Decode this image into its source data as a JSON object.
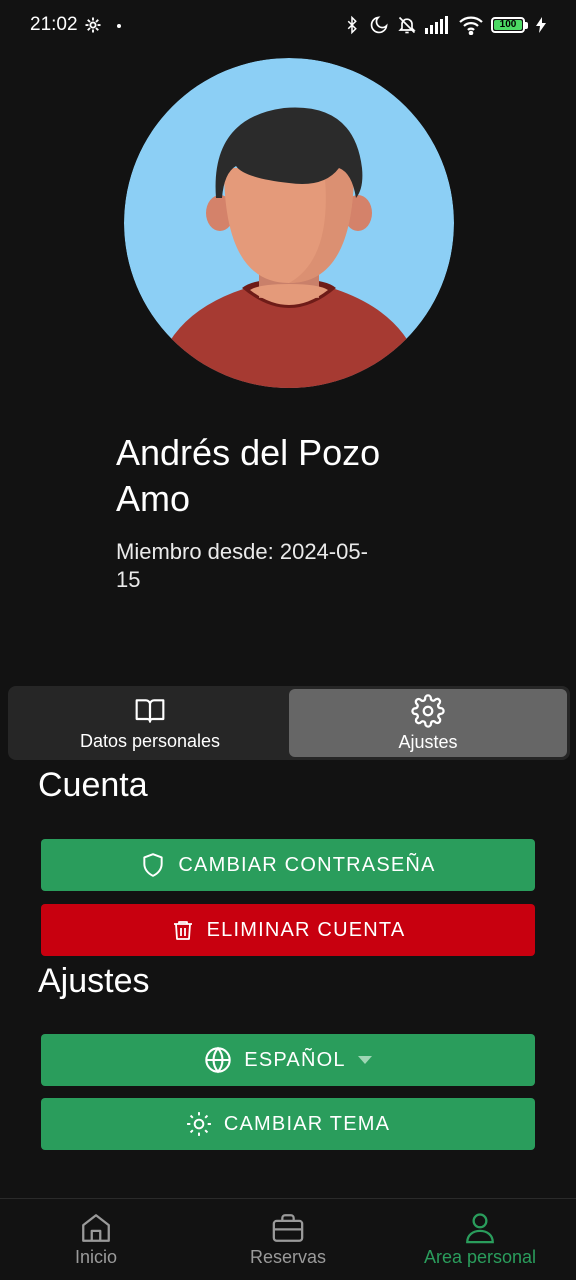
{
  "status_bar": {
    "time": "21:02",
    "battery_level": "100"
  },
  "profile": {
    "name": "Andrés del Pozo Amo",
    "member_since": "Miembro desde: 2024-05-15"
  },
  "tabs": [
    {
      "label": "Datos personales",
      "icon": "book-icon",
      "active": false
    },
    {
      "label": "Ajustes",
      "icon": "gear-icon",
      "active": true
    }
  ],
  "account_section": {
    "title": "Cuenta",
    "change_password_label": "CAMBIAR CONTRASEÑA",
    "delete_account_label": "ELIMINAR CUENTA"
  },
  "settings_section": {
    "title": "Ajustes",
    "language_label": "ESPAÑOL",
    "theme_label": "CAMBIAR TEMA"
  },
  "bottom_nav": [
    {
      "label": "Inicio",
      "icon": "home-icon",
      "active": false
    },
    {
      "label": "Reservas",
      "icon": "briefcase-icon",
      "active": false
    },
    {
      "label": "Area personal",
      "icon": "person-icon",
      "active": true
    }
  ],
  "colors": {
    "background": "#121212",
    "primary_green": "#2a9d5c",
    "danger_red": "#c8000f",
    "active_tab": "#666666"
  }
}
